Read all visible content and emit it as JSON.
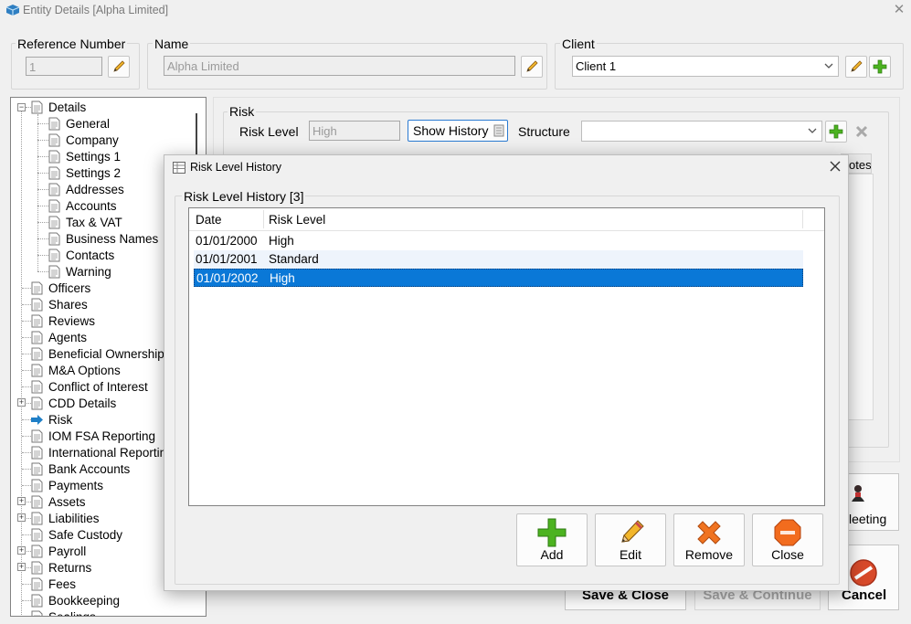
{
  "window": {
    "title": "Entity Details [Alpha Limited]",
    "close": "✕"
  },
  "reference": {
    "label": "Reference Number",
    "value": "1"
  },
  "name": {
    "label": "Name",
    "value": "Alpha Limited"
  },
  "client": {
    "label": "Client",
    "value": "Client 1"
  },
  "risk": {
    "group_label": "Risk",
    "level_label": "Risk Level",
    "level_value": "High",
    "show_history_label": "Show History",
    "structure_label": "Structure",
    "structure_value": ""
  },
  "background": {
    "tab_partial": "otes",
    "meeting_partial": "leeting",
    "save_close": "Save & Close",
    "save_continue": "Save & Continue",
    "cancel": "Cancel"
  },
  "tree": {
    "details": "Details",
    "children": [
      "General",
      "Company",
      "Settings 1",
      "Settings 2",
      "Addresses",
      "Accounts",
      "Tax & VAT",
      "Business Names",
      "Contacts",
      "Warning"
    ],
    "items": [
      {
        "label": "Officers"
      },
      {
        "label": "Shares"
      },
      {
        "label": "Reviews"
      },
      {
        "label": "Agents"
      },
      {
        "label": "Beneficial Ownership"
      },
      {
        "label": "M&A Options"
      },
      {
        "label": "Conflict of Interest"
      },
      {
        "label": "CDD Details",
        "expander": true
      },
      {
        "label": "Risk",
        "selected": true
      },
      {
        "label": "IOM FSA Reporting"
      },
      {
        "label": "International Reporting"
      },
      {
        "label": "Bank Accounts"
      },
      {
        "label": "Payments"
      },
      {
        "label": "Assets",
        "expander": true
      },
      {
        "label": "Liabilities",
        "expander": true
      },
      {
        "label": "Safe Custody"
      },
      {
        "label": "Payroll",
        "expander": true
      },
      {
        "label": "Returns",
        "expander": true
      },
      {
        "label": "Fees"
      },
      {
        "label": "Bookkeeping"
      },
      {
        "label": "Sealings"
      }
    ]
  },
  "modal": {
    "title": "Risk Level History",
    "group_label": "Risk Level History [3]",
    "columns": [
      "Date",
      "Risk Level"
    ],
    "rows": [
      {
        "date": "01/01/2000",
        "level": "High"
      },
      {
        "date": "01/01/2001",
        "level": "Standard"
      },
      {
        "date": "01/01/2002",
        "level": "High"
      }
    ],
    "selected_row": 2,
    "buttons": {
      "add": "Add",
      "edit": "Edit",
      "remove": "Remove",
      "close": "Close"
    }
  },
  "colors": {
    "selection": "#0a78d7",
    "row_alt": "#eef4fc",
    "add_green": "#4cb320",
    "remove_orange": "#f07320",
    "close_orange": "#f26c1e",
    "cancel_red": "#d84a2a"
  }
}
